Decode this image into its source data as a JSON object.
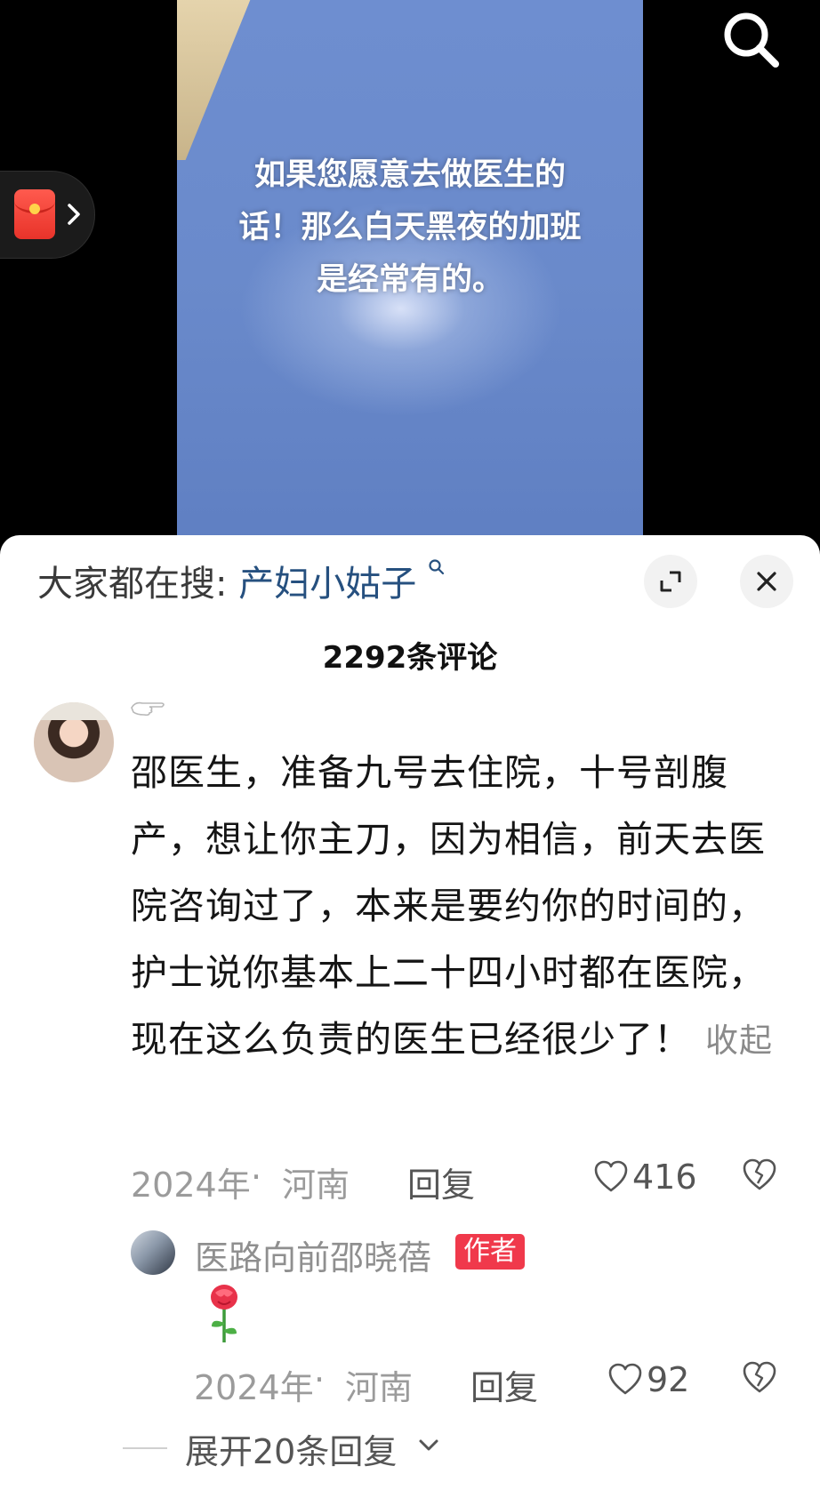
{
  "video": {
    "caption_lines": [
      "如果您愿意去做医生的",
      "话！那么白天黑夜的加班",
      "是经常有的。"
    ]
  },
  "icons": {
    "search": "search-icon",
    "red_packet": "red-packet-icon",
    "chevron": "chevron-right-icon",
    "expand": "expand-icon",
    "close": "close-icon",
    "like": "heart-outline-icon",
    "dislike": "broken-heart-icon",
    "rose": "rose-emoji",
    "pointing_hand": "pointing-hand-emoji"
  },
  "comments_sheet": {
    "search_prefix": "大家都在搜:",
    "search_keyword": "产妇小姑子",
    "count_label": "2292条评论"
  },
  "comment": {
    "text": "邵医生，准备九号去住院，十号剖腹产，想让你主刀，因为相信，前天去医院咨询过了，本来是要约你的时间的，护士说你基本上二十四小时都在医院，现在这么负责的医生已经很少了！",
    "collapse_label": "收起",
    "date": "2024年",
    "separator": "·",
    "region": "河南",
    "reply_label": "回复",
    "likes": "416"
  },
  "author_reply": {
    "name": "医路向前邵晓蓓",
    "badge": "作者",
    "date": "2024年",
    "separator": "·",
    "region": "河南",
    "reply_label": "回复",
    "likes": "92"
  },
  "expand_replies_label": "展开20条回复",
  "colors": {
    "author_badge": "#f0394b",
    "search_keyword": "#26507f",
    "video_bg": "#6a8acb"
  }
}
